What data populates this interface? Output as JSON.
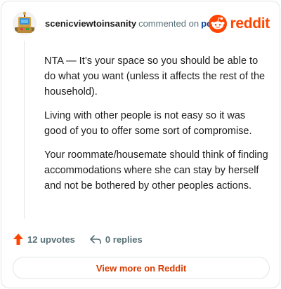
{
  "comment": {
    "username": "scenicviewtoinsanity",
    "action_text": "commented on",
    "post_link": "post",
    "paragraphs": [
      "NTA — It’s your space so you should be able to do what you want (unless it affects the rest of the household).",
      "Living with other people is not easy so it was good of you to offer some sort of compromise.",
      "Your roommate/housemate should think of finding accommodations where she can stay by herself and not be bothered by other peoples actions."
    ],
    "upvotes": "12 upvotes",
    "replies": "0 replies"
  },
  "brand": {
    "name": "reddit",
    "icon": "reddit-snoo-icon",
    "color": "#ff4500"
  },
  "footer": {
    "view_more_label": "View more on Reddit",
    "upvote_icon": "upvote-arrow-icon",
    "reply_icon": "reply-arrow-icon",
    "upvote_color": "#ff4500"
  }
}
